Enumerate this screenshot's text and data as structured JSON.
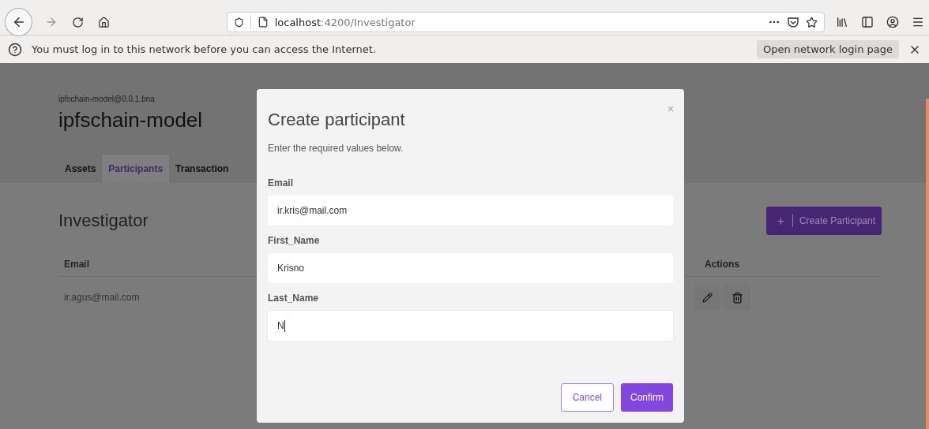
{
  "browser": {
    "url_host": "localhost",
    "url_path": ":4200/Investigator",
    "notification": {
      "message": "You must log in to this network before you can access the Internet.",
      "button": "Open network login page"
    }
  },
  "page": {
    "package": "ipfschain-model@0.0.1.bna",
    "title": "ipfschain-model",
    "tabs": [
      {
        "label": "Assets",
        "selected": false
      },
      {
        "label": "Participants",
        "selected": true
      },
      {
        "label": "Transaction",
        "selected": false
      }
    ],
    "section_title": "Investigator",
    "create_button": "Create Participant",
    "table": {
      "columns": [
        "Email",
        "Actions"
      ],
      "rows": [
        {
          "email": "ir.agus@mail.com"
        }
      ]
    }
  },
  "modal": {
    "title": "Create participant",
    "subtitle": "Enter the required values below.",
    "fields": [
      {
        "label": "Email",
        "value": "ir.kris@mail.com",
        "focused": false
      },
      {
        "label": "First_Name",
        "value": "Krisno",
        "focused": false
      },
      {
        "label": "Last_Name",
        "value": "N",
        "focused": true
      }
    ],
    "cancel": "Cancel",
    "confirm": "Confirm"
  }
}
